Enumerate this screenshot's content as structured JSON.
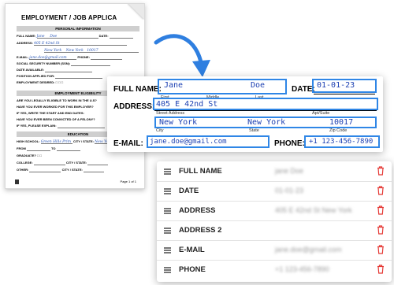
{
  "document": {
    "title": "EMPLOYMENT / JOB APPLICA",
    "section_personal": "PERSONAL INFORMATION",
    "section_eligibility": "EMPLOYMENT ELIGIBILITY",
    "section_education": "EDUCATION",
    "rows": {
      "full_name": "FULL NAME:",
      "full_name_first": "Jane",
      "full_name_last": "Doe",
      "date": "DATE:",
      "address": "ADDRESS:",
      "address_val": "405 E 42nd St",
      "city_val": "New York",
      "city_val2": "New York",
      "zip_val": "10017",
      "email": "E-MAIL:",
      "email_val": "jane.doe@gmail.com",
      "phone": "PHONE:",
      "ssn": "SOCIAL SECURITY NUMBER (SSN):",
      "date_available": "DATE AVAILABLE:",
      "position": "POSITION APPLIED FOR:",
      "employment_desired": "EMPLOYMENT DESIRED:",
      "elig1": "ARE YOU LEGALLY ELIGIBLE TO WORK IN THE U.S?",
      "elig2": "HAVE YOU EVER WORKED FOR THIS EMPLOYER?",
      "elig3": "IF YES, WRITE THE START AND END DATES:",
      "elig4": "HAVE YOU EVER BEEN CONVICTED OF A FELONY?",
      "elig5": "IF YES, PLEASE EXPLAIN:",
      "high_school": "HIGH SCHOOL:",
      "high_school_val": "Green Hills Prim",
      "city_state": "CITY / STATE:",
      "from": "FROM",
      "to": "TO",
      "graduate": "GRADUATE?",
      "college": "COLLEGE:",
      "other": "OTHER:",
      "page": "Page 1 of 1"
    }
  },
  "form": {
    "full_name_label": "FULL NAME:",
    "first_name_value": "Jane",
    "last_name_value": "Doe",
    "first_caption": "First",
    "middle_caption": "Middle",
    "last_caption": "Last",
    "date_label": "DATE:",
    "date_value": "01-01-23",
    "address_label": "ADDRESS:",
    "address_value": "405 E 42nd St",
    "street_caption": "Street Address",
    "apt_caption": "Apt/Suite",
    "city_value": "New York",
    "state_value": "New York",
    "zip_value": "10017",
    "city_caption": "City",
    "state_caption": "State",
    "zip_caption": "Zip Code",
    "email_label": "E-MAIL:",
    "email_value": "jane.doe@gmail.com",
    "phone_label": "PHONE:",
    "phone_value": "+1 123-456-7890"
  },
  "fields": [
    {
      "name": "FULL NAME",
      "value": "jane Doe",
      "icon": "trash-icon"
    },
    {
      "name": "DATE",
      "value": "01-01-23",
      "icon": "trash-icon"
    },
    {
      "name": "ADDRESS",
      "value": "405 E 42nd St New York",
      "icon": "trash-icon"
    },
    {
      "name": "ADDRESS 2",
      "value": "",
      "icon": "trash-icon"
    },
    {
      "name": "E-MAIL",
      "value": "jane.doe@gmail.com",
      "icon": "trash-icon"
    },
    {
      "name": "PHONE",
      "value": "+1 123-456-7890",
      "icon": "trash-icon"
    }
  ],
  "colors": {
    "highlight_box": "#2f86e6",
    "handwriting": "#1b3fb2",
    "arrow": "#2f7fe0",
    "trash": "#e53935"
  }
}
